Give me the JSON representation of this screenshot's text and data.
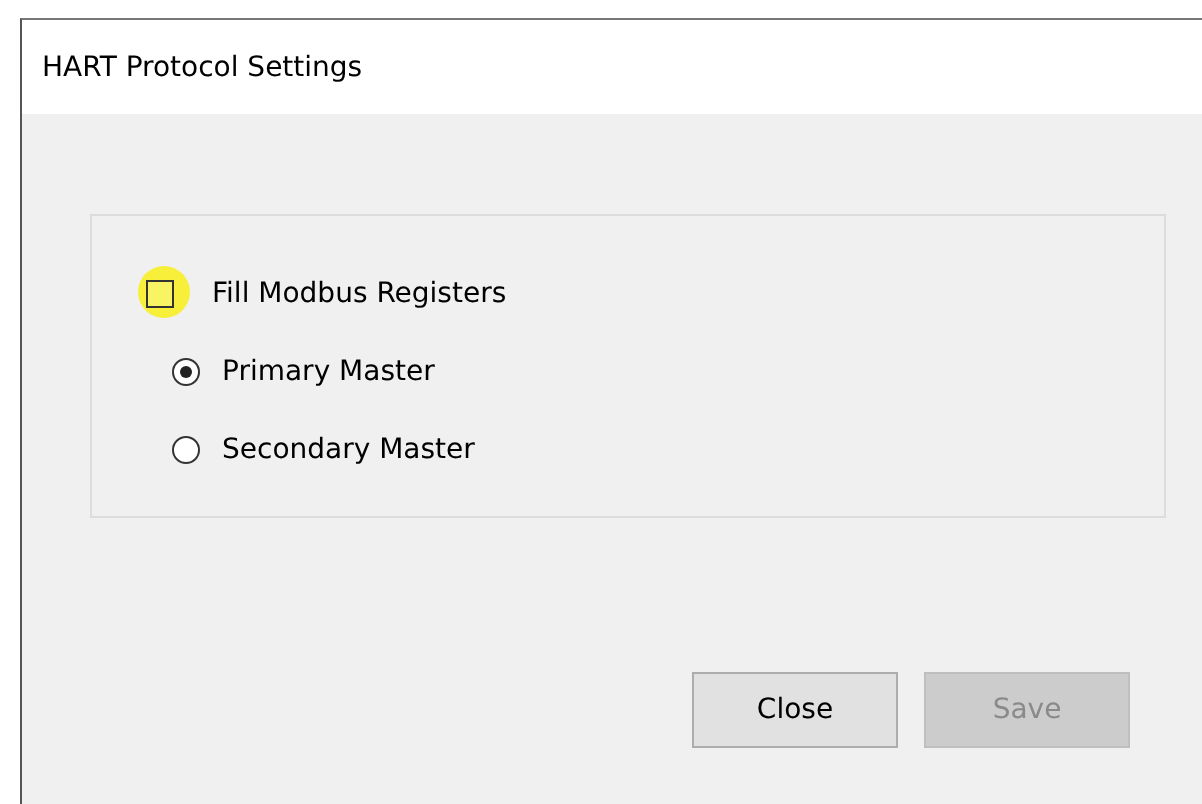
{
  "window": {
    "title": "HART Protocol Settings"
  },
  "checkbox": {
    "label": "Fill Modbus Registers",
    "checked": false,
    "highlighted": true
  },
  "radios": [
    {
      "label": "Primary Master",
      "selected": true
    },
    {
      "label": "Secondary Master",
      "selected": false
    }
  ],
  "buttons": [
    {
      "label": "Close",
      "disabled": false
    },
    {
      "label": "Save",
      "disabled": true
    }
  ]
}
